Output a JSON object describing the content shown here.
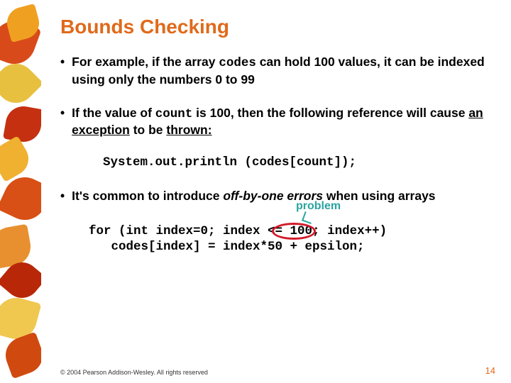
{
  "slide": {
    "title": "Bounds Checking",
    "bullets": [
      {
        "pre": "For example, if the array ",
        "mono1": "codes",
        "post": " can hold 100 values, it can be indexed using only the numbers 0 to 99"
      },
      {
        "pre": "If the value of ",
        "mono1": "count",
        "mid": " is 100, then the following reference will cause ",
        "ul1": "an exception",
        "mid2": " to be ",
        "ul2": "thrown:",
        "post": ""
      },
      {
        "pre": "It's common to introduce ",
        "em1": "off-by-one errors",
        "post": " when using arrays"
      }
    ],
    "code1": "System.out.println (codes[count]);",
    "code2_line1_a": "for (int index=0; index ",
    "code2_line1_op": "<= 100",
    "code2_line1_b": "; index++)",
    "code2_line2": "   codes[index] = index*50 + epsilon;",
    "problem_label": "problem",
    "footer": "© 2004 Pearson Addison-Wesley. All rights reserved",
    "page": "14"
  }
}
